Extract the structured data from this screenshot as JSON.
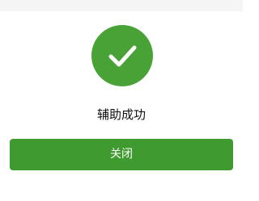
{
  "dialog": {
    "message": "辅助成功",
    "close_label": "关闭",
    "status_icon": "check-circle-icon"
  },
  "colors": {
    "success_green": "#48a236",
    "button_green": "#3f9a2f",
    "top_bar": "#f5f5f5",
    "text": "#111111",
    "background": "#ffffff"
  }
}
